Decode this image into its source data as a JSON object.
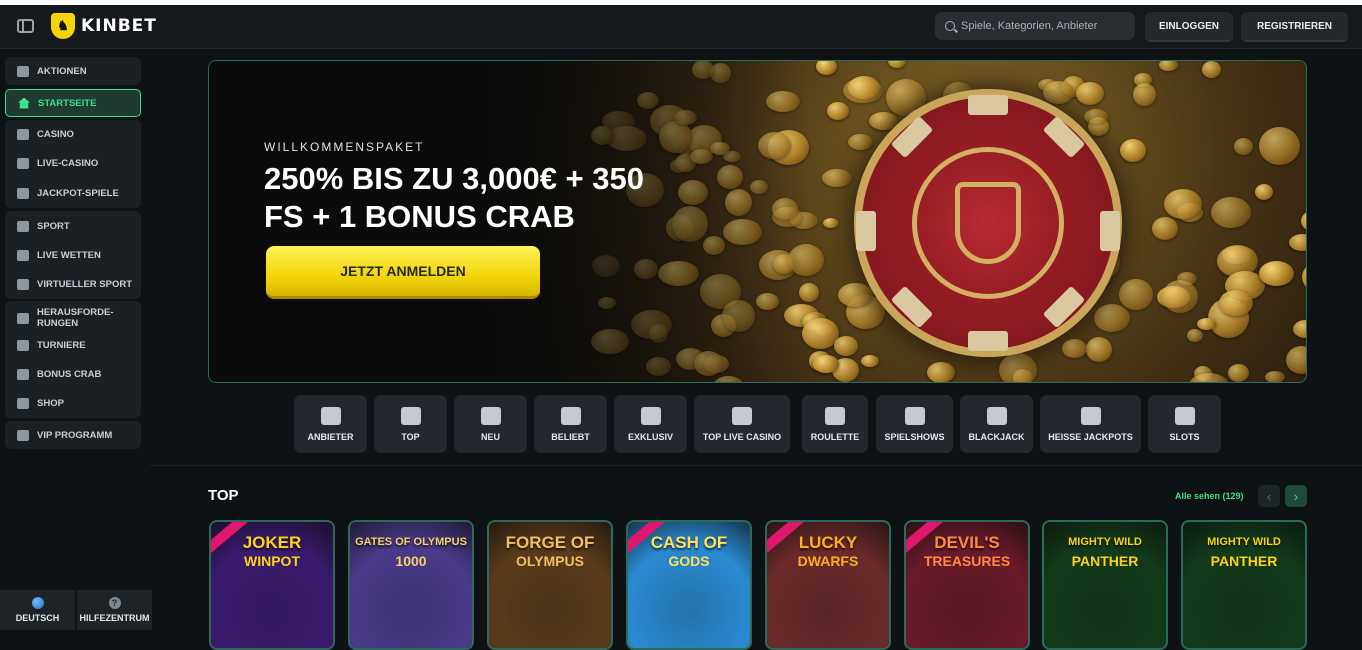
{
  "header": {
    "logo_text": "KINBET",
    "search_placeholder": "Spiele, Kategorien, Anbieter",
    "login_label": "EINLOGGEN",
    "register_label": "REGISTRIEREN"
  },
  "sidebar": {
    "items": [
      {
        "label": "AKTIONEN",
        "icon": "gift-icon"
      },
      {
        "label": "STARTSEITE",
        "icon": "home-icon",
        "active": true
      },
      {
        "label": "CASINO",
        "icon": "cards-icon"
      },
      {
        "label": "LIVE-CASINO",
        "icon": "live-casino-icon"
      },
      {
        "label": "JACKPOT-SPIELE",
        "icon": "clover-icon"
      },
      {
        "label": "SPORT",
        "icon": "ball-icon"
      },
      {
        "label": "LIVE WETTEN",
        "icon": "live-icon"
      },
      {
        "label": "VIRTUELLER SPORT",
        "icon": "virtual-icon"
      },
      {
        "label": "HERAUSFORDE-\nRUNGEN",
        "icon": "challenge-icon"
      },
      {
        "label": "TURNIERE",
        "icon": "trophy-icon"
      },
      {
        "label": "BONUS CRAB",
        "icon": "crab-icon"
      },
      {
        "label": "SHOP",
        "icon": "basket-icon"
      },
      {
        "label": "VIP PROGRAMM",
        "icon": "diamond-icon"
      }
    ],
    "language_label": "DEUTSCH",
    "help_label": "HILFEZENTRUM"
  },
  "banner": {
    "subtitle": "WILLKOMMENSPAKET",
    "title": "250% BIS ZU 3,000€ + 350 FS + 1 BONUS CRAB",
    "cta_label": "JETZT ANMELDEN"
  },
  "categories": [
    {
      "label": "ANBIETER",
      "icon": "book-icon"
    },
    {
      "label": "TOP",
      "icon": "crown-icon"
    },
    {
      "label": "NEU",
      "icon": "clover-icon"
    },
    {
      "label": "BELIEBT",
      "icon": "bomb-icon"
    },
    {
      "label": "EXKLUSIV",
      "icon": "diamond-icon"
    },
    {
      "label": "TOP LIVE CASINO",
      "icon": "flag-icon"
    },
    {
      "label": "ROULETTE",
      "icon": "roulette-icon"
    },
    {
      "label": "SPIELSHOWS",
      "icon": "mic-icon"
    },
    {
      "label": "BLACKJACK",
      "icon": "spade-icon"
    },
    {
      "label": "HEISSE JACKPOTS",
      "icon": "fire-icon"
    },
    {
      "label": "SLOTS",
      "icon": "slot-icon"
    }
  ],
  "top_section": {
    "title": "TOP",
    "see_all_label": "Alle sehen (129)",
    "games": [
      {
        "title": "JOKER",
        "subtitle": "WINPOT",
        "bg": "#3a1a6e",
        "color": "#ffd21a"
      },
      {
        "title": "GATES OF OLYMPUS",
        "subtitle": "1000",
        "bg": "#4a3a8a",
        "color": "#f5d36a"
      },
      {
        "title": "FORGE OF",
        "subtitle": "OLYMPUS",
        "bg": "#5a3a1a",
        "color": "#f0c060"
      },
      {
        "title": "CASH OF",
        "subtitle": "GODS",
        "bg": "#2a8ad0",
        "color": "#ffe05a"
      },
      {
        "title": "LUCKY",
        "subtitle": "DWARFS",
        "bg": "#6a2a2a",
        "color": "#ffb020"
      },
      {
        "title": "DEVIL'S",
        "subtitle": "TREASURES",
        "bg": "#6a1a2a",
        "color": "#ff8a40"
      },
      {
        "title": "MIGHTY WILD",
        "subtitle": "PANTHER",
        "bg": "#123a1a",
        "color": "#ffd21a"
      },
      {
        "title": "MIGHTY WILD",
        "subtitle": "PANTHER",
        "bg": "#123a1a",
        "color": "#ffd21a"
      }
    ]
  }
}
